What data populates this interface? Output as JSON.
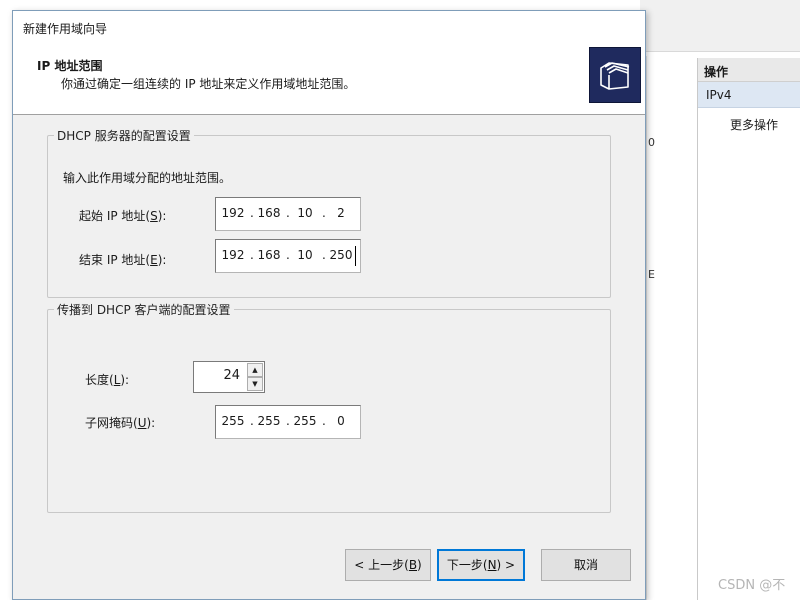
{
  "dialog": {
    "title": "新建作用域向导",
    "header_title": "IP 地址范围",
    "header_subtitle": "你通过确定一组连续的 IP 地址来定义作用域地址范围。",
    "icon": "folders-wizard-icon"
  },
  "server_config": {
    "legend": "DHCP 服务器的配置设置",
    "instruction": "输入此作用域分配的地址范围。",
    "start_ip": {
      "label_prefix": "起始 IP 地址(",
      "accel": "S",
      "label_suffix": "):",
      "octets": [
        "192",
        "168",
        "10",
        "2"
      ]
    },
    "end_ip": {
      "label_prefix": "结束 IP 地址(",
      "accel": "E",
      "label_suffix": "):",
      "octets": [
        "192",
        "168",
        "10",
        "250"
      ]
    }
  },
  "client_config": {
    "legend": "传播到 DHCP 客户端的配置设置",
    "length": {
      "label_prefix": "长度(",
      "accel": "L",
      "label_suffix": "):",
      "value": "24"
    },
    "subnet_mask": {
      "label_prefix": "子网掩码(",
      "accel": "U",
      "label_suffix": "):",
      "octets": [
        "255",
        "255",
        "255",
        "0"
      ]
    }
  },
  "buttons": {
    "back": {
      "prefix": "< 上一步(",
      "accel": "B",
      "suffix": ")"
    },
    "next": {
      "prefix": "下一步(",
      "accel": "N",
      "suffix": ") >"
    },
    "cancel": {
      "label": "取消"
    }
  },
  "background": {
    "actions_header": "操作",
    "actions_section": "IPv4",
    "actions_more": "更多操作",
    "fragment_1": "0",
    "fragment_2": "E"
  },
  "watermark": "CSDN @不"
}
